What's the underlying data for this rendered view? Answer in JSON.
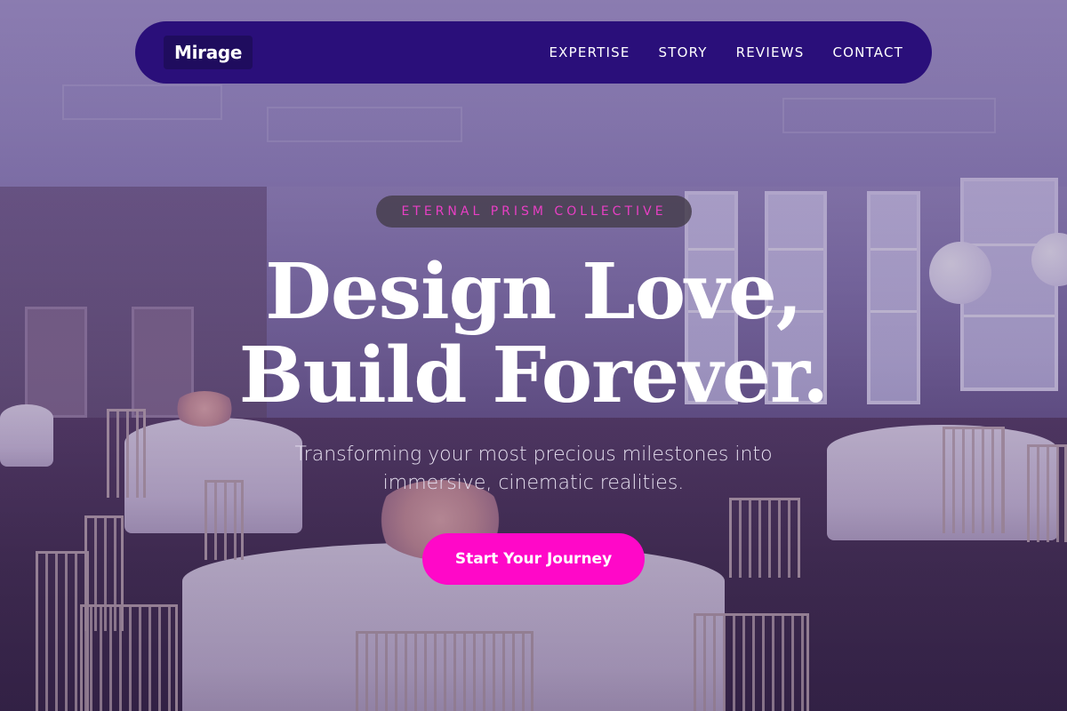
{
  "brand": {
    "logo": "Mirage"
  },
  "nav": {
    "items": [
      {
        "label": "EXPERTISE"
      },
      {
        "label": "STORY"
      },
      {
        "label": "REVIEWS"
      },
      {
        "label": "CONTACT"
      }
    ]
  },
  "hero": {
    "tagline": "ETERNAL PRISM COLLECTIVE",
    "headline_line1": "Design Love,",
    "headline_line2": "Build Forever.",
    "subtitle": "Transforming your most precious milestones into immersive, cinematic realities.",
    "cta_label": "Start Your Journey"
  },
  "colors": {
    "navbar_bg": "#2a0f7a",
    "accent": "#ff08c8",
    "tagline_text": "#e83fc4"
  }
}
